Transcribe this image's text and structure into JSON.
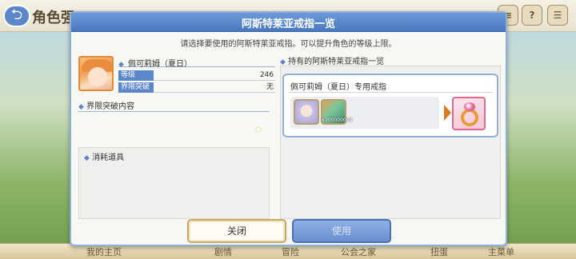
{
  "background": {
    "title": "角色强",
    "icons": [
      {
        "name": "sort-icon",
        "glyph": "≡"
      },
      {
        "name": "help-icon",
        "glyph": "?"
      },
      {
        "name": "menu-icon",
        "glyph": "☰"
      }
    ],
    "bottom_tabs": [
      "我的主页",
      "剧情",
      "冒险",
      "公会之家",
      "扭蛋",
      "主菜单"
    ]
  },
  "dialog": {
    "title": "阿斯特莱亚戒指一览",
    "instruction": "请选择要使用的阿斯特莱亚戒指。可以提升角色的等级上限。",
    "character": {
      "name": "佩可莉姆（夏日）",
      "stats": [
        {
          "label": "等级",
          "value": "246"
        },
        {
          "label": "界限突破",
          "value": "无"
        }
      ]
    },
    "sections": {
      "limit_break": "界限突破内容",
      "consumables": "消耗道具",
      "owned_rings": "持有的阿斯特莱亚戒指一览"
    },
    "ring_card": {
      "title": "佩可莉姆（夏日）专用戒指",
      "item_count": "×300000000"
    },
    "buttons": {
      "close": "关闭",
      "use": "使用"
    }
  },
  "colors": {
    "header_blue": "#4a78c0",
    "accent_orange": "#e07a1e",
    "use_button": "#6a8fce"
  }
}
